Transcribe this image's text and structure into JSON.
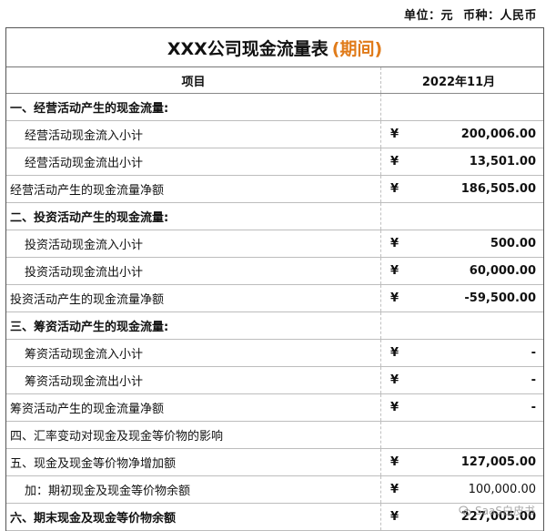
{
  "unit": {
    "unit_label": "单位：元",
    "currency_label": "币种：人民币"
  },
  "title": {
    "main": "XXX公司现金流量表",
    "period": "(期间)"
  },
  "header": {
    "item": "项目",
    "period": "2022年11月"
  },
  "rows": [
    {
      "label": "一、经营活动产生的现金流量:",
      "currency": "",
      "amount": ""
    },
    {
      "label": "经营活动现金流入小计",
      "currency": "¥",
      "amount": "200,006.00"
    },
    {
      "label": "经营活动现金流出小计",
      "currency": "¥",
      "amount": "13,501.00"
    },
    {
      "label": "经营活动产生的现金流量净额",
      "currency": "¥",
      "amount": "186,505.00"
    },
    {
      "label": "二、投资活动产生的现金流量:",
      "currency": "",
      "amount": ""
    },
    {
      "label": "投资活动现金流入小计",
      "currency": "¥",
      "amount": "500.00"
    },
    {
      "label": "投资活动现金流出小计",
      "currency": "¥",
      "amount": "60,000.00"
    },
    {
      "label": "投资活动产生的现金流量净额",
      "currency": "¥",
      "amount": "-59,500.00"
    },
    {
      "label": "三、筹资活动产生的现金流量:",
      "currency": "",
      "amount": ""
    },
    {
      "label": "筹资活动现金流入小计",
      "currency": "¥",
      "amount": "-"
    },
    {
      "label": "筹资活动现金流出小计",
      "currency": "¥",
      "amount": "-"
    },
    {
      "label": "筹资活动产生的现金流量净额",
      "currency": "¥",
      "amount": "-"
    },
    {
      "label": "四、汇率变动对现金及现金等价物的影响",
      "currency": "",
      "amount": ""
    },
    {
      "label": "五、现金及现金等价物净增加额",
      "currency": "¥",
      "amount": "127,005.00"
    },
    {
      "label": "加：期初现金及现金等价物余额",
      "currency": "¥",
      "amount": "100,000.00"
    },
    {
      "label": "六、期末现金及现金等价物余额",
      "currency": "¥",
      "amount": "227,005.00"
    }
  ],
  "watermark": {
    "text": "SaaS白皮书",
    "icon": "wechat-icon"
  }
}
